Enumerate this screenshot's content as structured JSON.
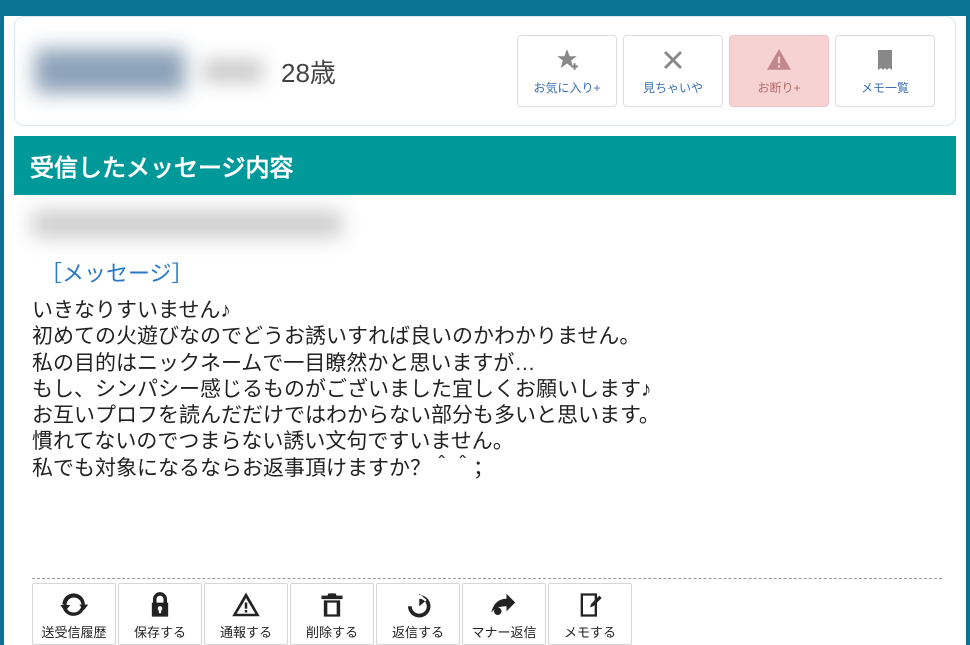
{
  "user": {
    "age": "28歳"
  },
  "top_actions": {
    "favorite": {
      "label": "お気に入り+"
    },
    "ignore": {
      "label": "見ちゃいや"
    },
    "reject": {
      "label": "お断り+"
    },
    "memo": {
      "label": "メモ一覧"
    }
  },
  "section_title": "受信したメッセージ内容",
  "message": {
    "label": "［メッセージ］",
    "body": "いきなりすいません♪\n初めての火遊びなのでどうお誘いすれば良いのかわかりません。\n私の目的はニックネームで一目瞭然かと思いますが…\nもし、シンパシー感じるものがございました宜しくお願いします♪\nお互いプロフを読んだだけではわからない部分も多いと思います。\n慣れてないのでつまらない誘い文句ですいません。\n私でも対象になるならお返事頂けますか？＾＾；"
  },
  "bottom_actions": {
    "history": {
      "label": "送受信履歴"
    },
    "save": {
      "label": "保存する"
    },
    "report": {
      "label": "通報する"
    },
    "delete": {
      "label": "削除する"
    },
    "reply": {
      "label": "返信する"
    },
    "manner_reply": {
      "label": "マナー返信"
    },
    "memo": {
      "label": "メモする"
    }
  }
}
